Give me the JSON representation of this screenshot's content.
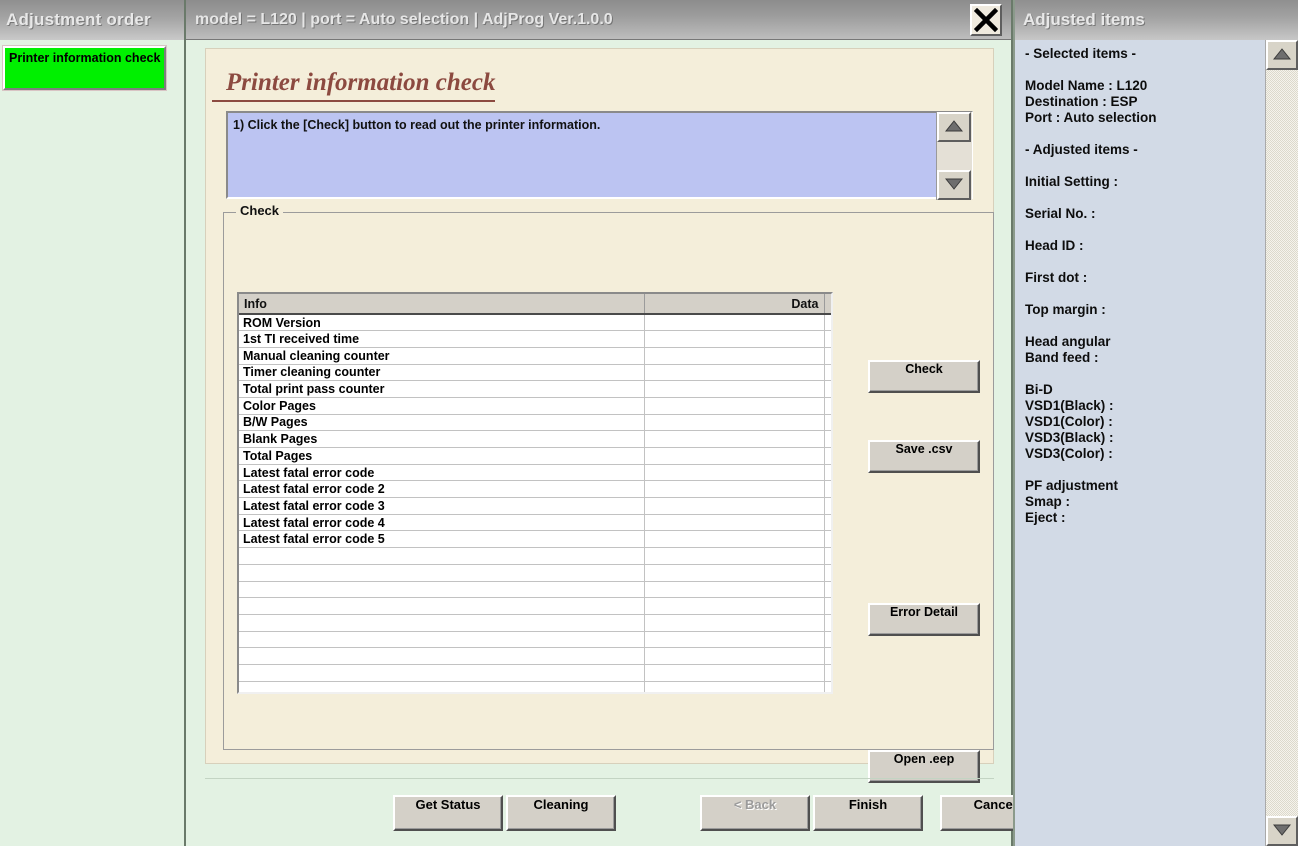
{
  "sidebar": {
    "title": "Adjustment order",
    "items": [
      {
        "label": "Printer information check",
        "state": "selected",
        "color": "#00f000"
      }
    ]
  },
  "titlebar": {
    "text": "model = L120 | port = Auto selection | AdjProg Ver.1.0.0",
    "close_icon": "close-icon"
  },
  "main": {
    "page_title": "Printer information check",
    "instructions": "1) Click the [Check] button to read out the printer information.",
    "group_label": "Check",
    "table": {
      "columns": [
        "Info",
        "Data",
        ""
      ],
      "rows": [
        [
          "ROM Version",
          "",
          ""
        ],
        [
          "1st TI received time",
          "",
          ""
        ],
        [
          "Manual cleaning counter",
          "",
          ""
        ],
        [
          "Timer cleaning counter",
          "",
          ""
        ],
        [
          "Total print pass counter",
          "",
          ""
        ],
        [
          "Color Pages",
          "",
          ""
        ],
        [
          "B/W Pages",
          "",
          ""
        ],
        [
          "Blank Pages",
          "",
          ""
        ],
        [
          "Total Pages",
          "",
          ""
        ],
        [
          "Latest fatal error code",
          "",
          ""
        ],
        [
          "Latest fatal error code 2",
          "",
          ""
        ],
        [
          "Latest fatal error code 3",
          "",
          ""
        ],
        [
          "Latest fatal error code 4",
          "",
          ""
        ],
        [
          "Latest fatal error code 5",
          "",
          ""
        ],
        [
          "",
          "",
          ""
        ],
        [
          "",
          "",
          ""
        ],
        [
          "",
          "",
          ""
        ],
        [
          "",
          "",
          ""
        ],
        [
          "",
          "",
          ""
        ],
        [
          "",
          "",
          ""
        ],
        [
          "",
          "",
          ""
        ],
        [
          "",
          "",
          ""
        ],
        [
          "",
          "",
          ""
        ]
      ]
    },
    "buttons": {
      "check": "Check",
      "save_csv": "Save .csv",
      "error_detail": "Error Detail",
      "open_eep": "Open .eep"
    }
  },
  "footer": {
    "get_status": "Get Status",
    "cleaning": "Cleaning",
    "back": "< Back",
    "finish": "Finish",
    "cancel": "Cancel"
  },
  "right_panel": {
    "title": "Adjusted items",
    "selected_heading": "- Selected items -",
    "model_name": "Model Name : L120",
    "destination": "Destination : ESP",
    "port": "Port : Auto selection",
    "adjusted_heading": "- Adjusted items -",
    "initial_setting": "Initial Setting :",
    "serial_no": "Serial No. :",
    "head_id": "Head ID :",
    "first_dot": "First dot :",
    "top_margin": "Top margin :",
    "head_angular": "Head angular",
    "band_feed": " Band feed :",
    "bi_d": "Bi-D",
    "vsd1_black": " VSD1(Black) :",
    "vsd1_color": " VSD1(Color) :",
    "vsd3_black": " VSD3(Black) :",
    "vsd3_color": " VSD3(Color) :",
    "pf_adjustment": "PF adjustment",
    "smap": " Smap :",
    "eject": "Eject :"
  },
  "colors": {
    "sidebar_bg": "#e3f2e3",
    "content_bg": "#f4eeda",
    "right_bg": "#d2dae6",
    "instruction_bg": "#bcc4f2",
    "selected_item": "#00f000",
    "title_accent": "#8c4a40"
  }
}
